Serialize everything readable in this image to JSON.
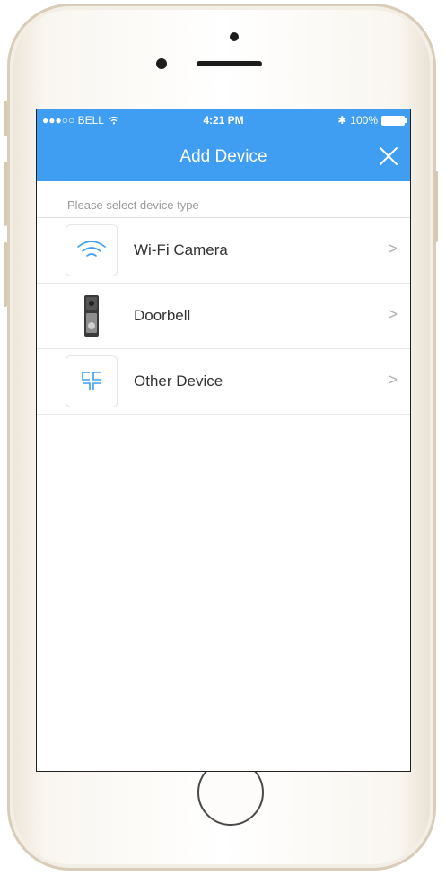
{
  "status_bar": {
    "carrier": "●●●○○ BELL",
    "time": "4:21 PM",
    "battery": "100%"
  },
  "nav": {
    "title": "Add Device"
  },
  "hint": "Please select device type",
  "devices": [
    {
      "label": "Wi-Fi Camera",
      "icon": "wifi-icon"
    },
    {
      "label": "Doorbell",
      "icon": "doorbell-icon"
    },
    {
      "label": "Other Device",
      "icon": "other-device-icon"
    }
  ],
  "colors": {
    "accent": "#3f9df2",
    "icon_blue": "#3f9df2"
  }
}
